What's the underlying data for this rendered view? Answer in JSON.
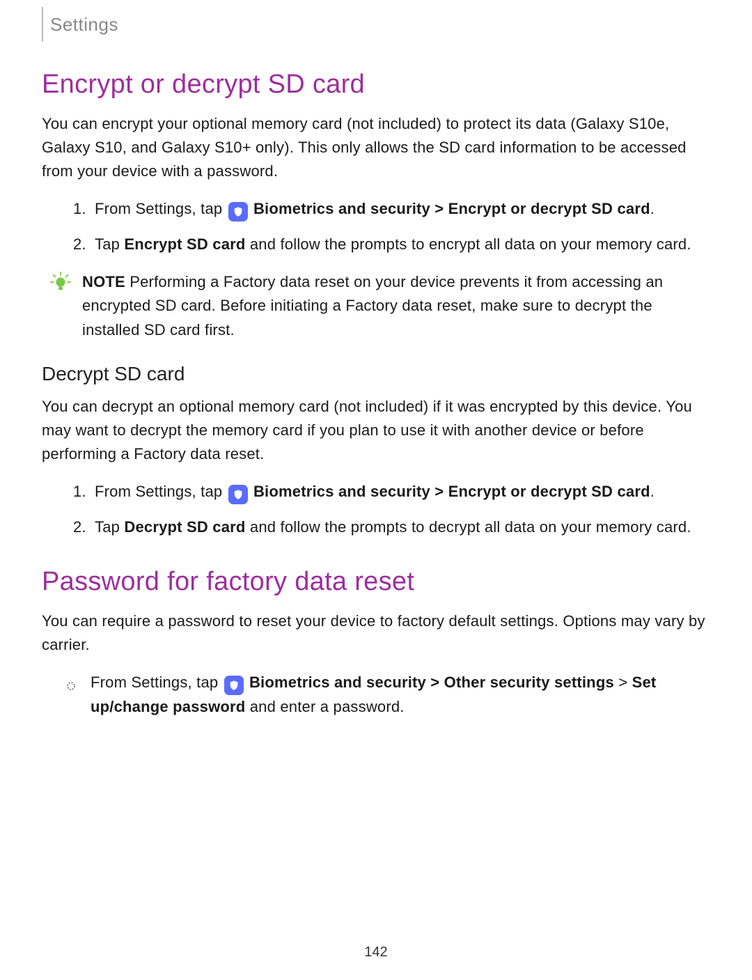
{
  "header": {
    "label": "Settings"
  },
  "sections": {
    "encrypt": {
      "title": "Encrypt or decrypt SD card",
      "intro": "You can encrypt your optional memory card (not included) to protect its data (Galaxy S10e, Galaxy S10, and Galaxy S10+ only). This only allows the SD card information to be accessed from your device with a password.",
      "step1_prefix": "From Settings, tap ",
      "step1_bold": "Biometrics and security > Encrypt or decrypt SD card",
      "step1_suffix": ".",
      "step2_prefix": "Tap ",
      "step2_bold": "Encrypt SD card",
      "step2_suffix": " and follow the prompts to encrypt all data on your memory card.",
      "note_label": "NOTE",
      "note_text": "  Performing a Factory data reset on your device prevents it from accessing an encrypted SD card. Before initiating a Factory data reset, make sure to decrypt the installed SD card first."
    },
    "decrypt": {
      "title": "Decrypt SD card",
      "intro": "You can decrypt an optional memory card (not included) if it was encrypted by this device. You may want to decrypt the memory card if you plan to use it with another device or before performing a Factory data reset.",
      "step1_prefix": "From Settings, tap ",
      "step1_bold": "Biometrics and security > Encrypt or decrypt SD card",
      "step1_suffix": ".",
      "step2_prefix": "Tap ",
      "step2_bold": "Decrypt SD card",
      "step2_suffix": " and follow the prompts to decrypt all data on your memory card."
    },
    "password": {
      "title": "Password for factory data reset",
      "intro": "You can require a password to reset your device to factory default settings. Options may vary by carrier.",
      "bullet_prefix": "From Settings, tap ",
      "bullet_bold1": "Biometrics and security > Other security settings",
      "bullet_mid": " > ",
      "bullet_bold2": "Set up/change password",
      "bullet_suffix": " and enter a password."
    }
  },
  "page_number": "142"
}
